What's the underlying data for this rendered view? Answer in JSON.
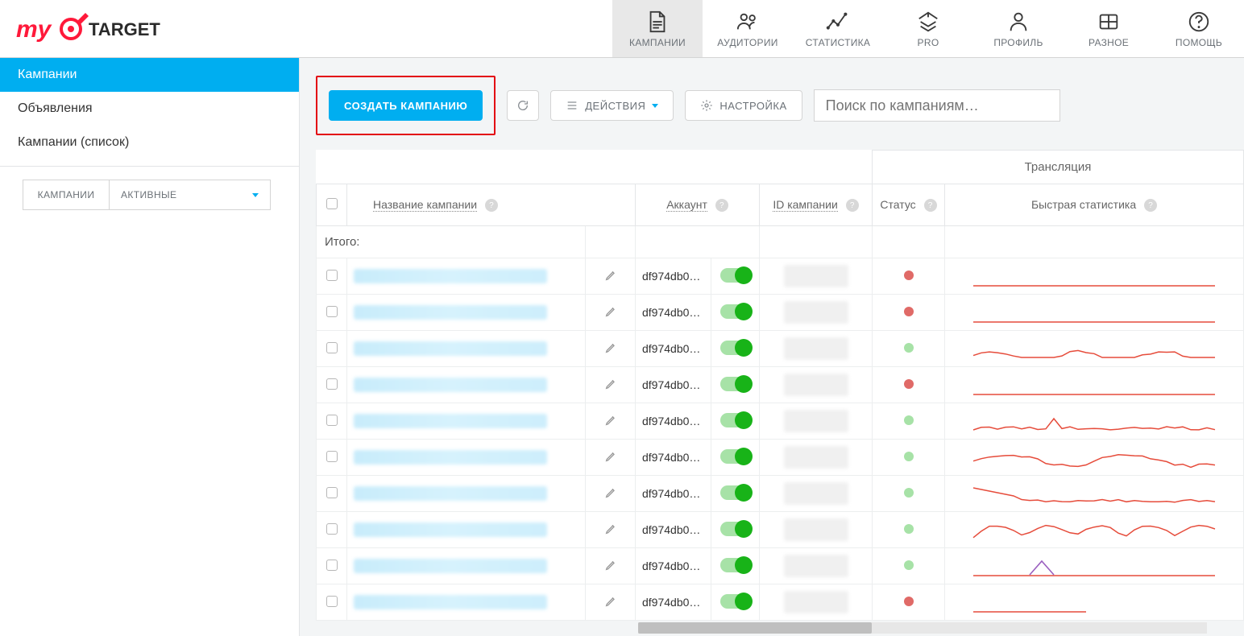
{
  "nav": {
    "items": [
      {
        "label": "КАМПАНИИ",
        "icon": "document"
      },
      {
        "label": "АУДИТОРИИ",
        "icon": "people"
      },
      {
        "label": "СТАТИСТИКА",
        "icon": "stats"
      },
      {
        "label": "PRO",
        "icon": "pro"
      },
      {
        "label": "ПРОФИЛЬ",
        "icon": "profile"
      },
      {
        "label": "РАЗНОЕ",
        "icon": "misc"
      },
      {
        "label": "ПОМОЩЬ",
        "icon": "help"
      }
    ]
  },
  "sidebar": {
    "items": [
      {
        "label": "Кампании"
      },
      {
        "label": "Объявления"
      },
      {
        "label": "Кампании (список)"
      }
    ],
    "filters": {
      "left": "КАМПАНИИ",
      "right": "АКТИВНЫЕ"
    }
  },
  "toolbar": {
    "create": "СОЗДАТЬ КАМПАНИЮ",
    "actions_label": "ДЕЙСТВИЯ",
    "settings_label": "НАСТРОЙКА",
    "search_placeholder": "Поиск по кампаниям…"
  },
  "table": {
    "over_header": "Трансляция",
    "headers": {
      "name": "Название кампании",
      "account": "Аккаунт",
      "id": "ID кампании",
      "status": "Статус",
      "quickstats": "Быстрая статистика"
    },
    "totals_label": "Итого:",
    "rows": [
      {
        "account": "df974db0…",
        "status": "red",
        "spark": "flat"
      },
      {
        "account": "df974db0…",
        "status": "red",
        "spark": "flat"
      },
      {
        "account": "df974db0…",
        "status": "green",
        "spark": "wave1"
      },
      {
        "account": "df974db0…",
        "status": "red",
        "spark": "flat"
      },
      {
        "account": "df974db0…",
        "status": "green",
        "spark": "wave2"
      },
      {
        "account": "df974db0…",
        "status": "green",
        "spark": "wave3"
      },
      {
        "account": "df974db0…",
        "status": "green",
        "spark": "wave4"
      },
      {
        "account": "df974db0…",
        "status": "green",
        "spark": "wave5"
      },
      {
        "account": "df974db0…",
        "status": "green",
        "spark": "wave6"
      },
      {
        "account": "df974db0…",
        "status": "red",
        "spark": "part"
      }
    ]
  }
}
